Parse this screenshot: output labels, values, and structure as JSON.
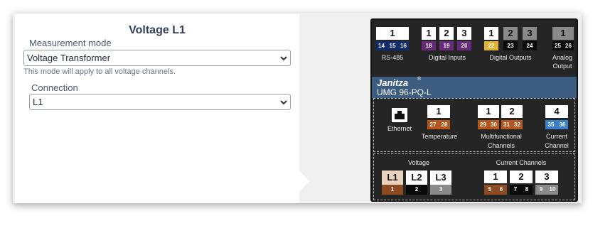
{
  "panel": {
    "title": "Voltage L1",
    "measurement_mode_label": "Measurement mode",
    "measurement_mode_value": "Voltage Transformer",
    "mode_hint": "This mode will apply to all voltage channels.",
    "connection_label": "Connection",
    "connection_value": "L1"
  },
  "device": {
    "rs485": {
      "num": "1",
      "pins": [
        "14",
        "15",
        "16"
      ],
      "label": "RS-485"
    },
    "digital_inputs": {
      "nums": [
        "1",
        "2",
        "3"
      ],
      "pins": [
        "18",
        "19",
        "20"
      ],
      "label": "Digital Inputs"
    },
    "digital_outputs": {
      "nums": [
        "1",
        "2",
        "3"
      ],
      "pins": [
        "22",
        "23",
        "24"
      ],
      "label": "Digital Outputs"
    },
    "analog_output": {
      "num": "1",
      "pins": [
        "25",
        "26"
      ],
      "label_1": "Analog",
      "label_2": "Output"
    },
    "brand": "Janitza",
    "brand_mark": "®",
    "model": "UMG 96-PQ-L",
    "ethernet_label": "Ethernet",
    "temperature": {
      "num": "1",
      "pins": [
        "27",
        "28"
      ],
      "label": "Temperature"
    },
    "multifunctional": {
      "nums": [
        "1",
        "2"
      ],
      "pins": [
        "29",
        "30",
        "31",
        "32"
      ],
      "label_1": "Multifunctional",
      "label_2": "Channels"
    },
    "current_channel": {
      "num": "4",
      "pins": [
        "35",
        "36"
      ],
      "label_1": "Current",
      "label_2": "Channel"
    },
    "voltage": {
      "label": "Voltage",
      "channels": [
        "L1",
        "L2",
        "L3"
      ],
      "pins": [
        "1",
        "2",
        "3"
      ]
    },
    "current_channels": {
      "label": "Current Channels",
      "nums": [
        "1",
        "2",
        "3"
      ],
      "pins": [
        "5",
        "6",
        "7",
        "8",
        "9",
        "10"
      ]
    },
    "colors": {
      "rs485": "#0f2d6e",
      "digital_inputs": "#6a2a7c",
      "digital_out_1": "#e2b330",
      "dark": "#0a0a0a",
      "copper": "#b5561c",
      "blue": "#3a7fc9",
      "brown": "#8e4b22",
      "gray": "#8a8a8a",
      "brand": "#3d5d80"
    }
  }
}
